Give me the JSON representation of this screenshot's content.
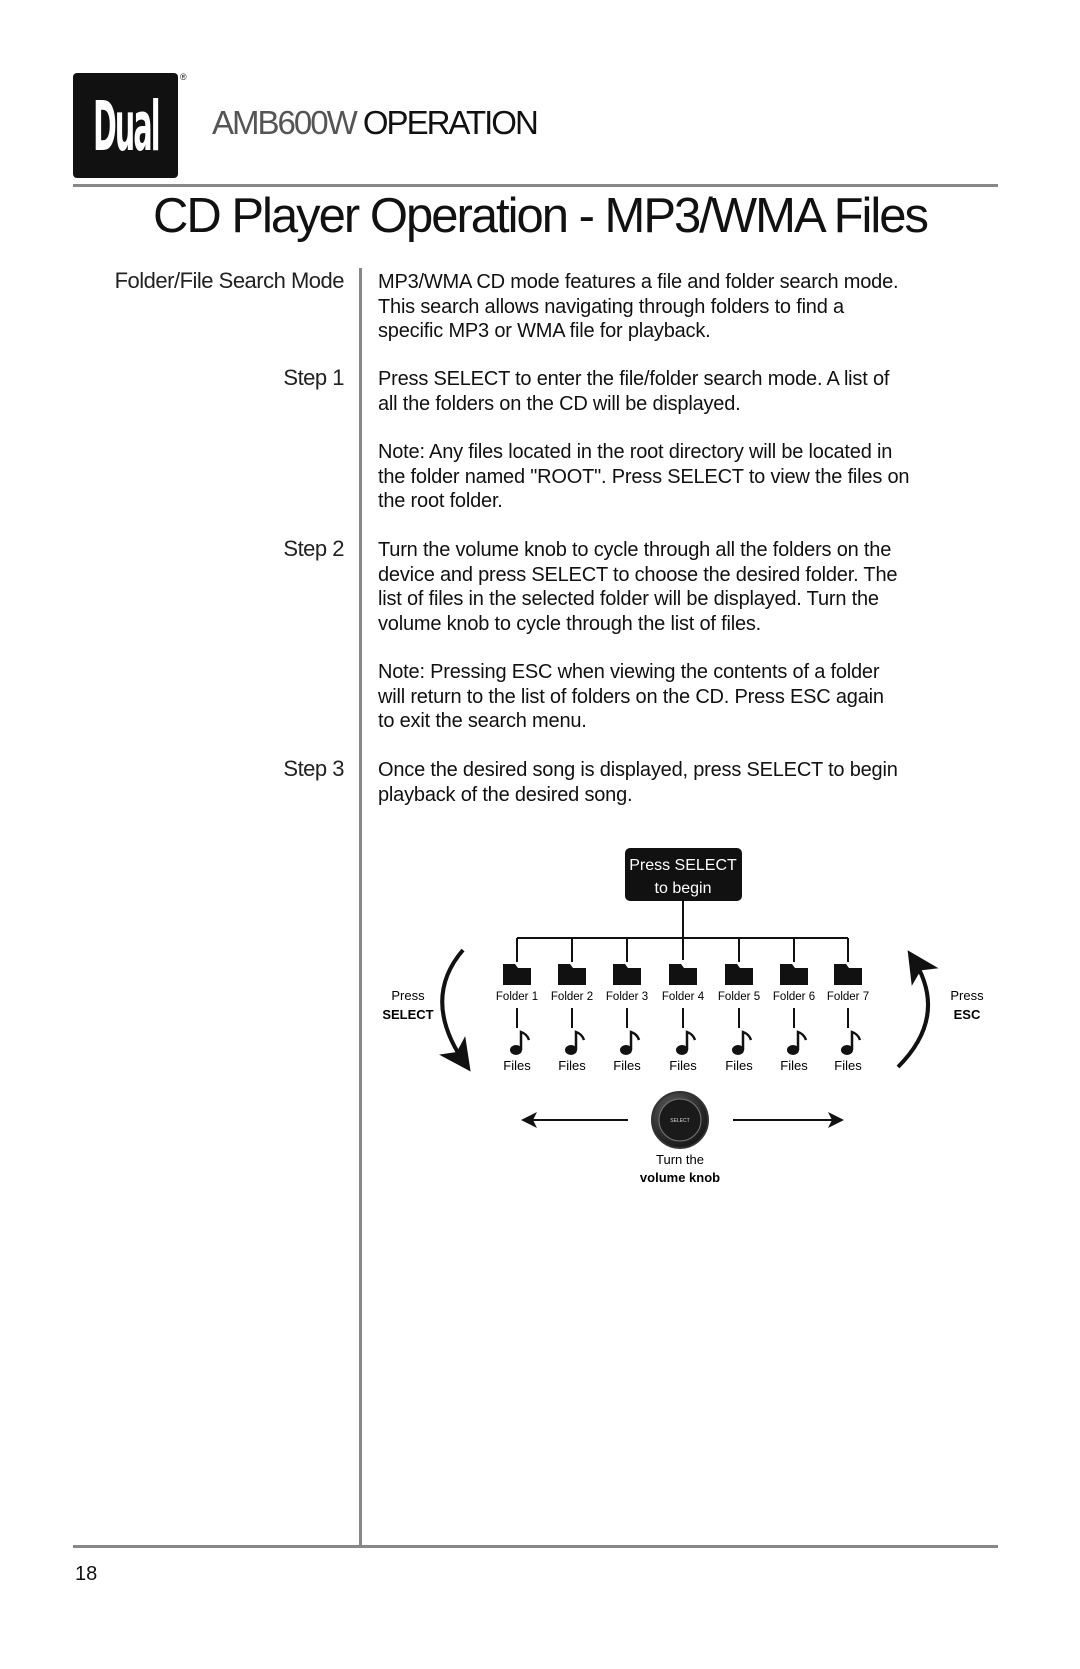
{
  "header": {
    "logo_text": "Dual",
    "model": "AMB600W",
    "section": "OPERATION"
  },
  "title": "CD Player Operation - MP3/WMA Files",
  "labels": {
    "mode": "Folder/File Search Mode",
    "step1": "Step 1",
    "step2": "Step 2",
    "step3": "Step 3"
  },
  "paragraphs": {
    "intro": [
      "MP3/WMA CD mode features a file and folder search mode.",
      "This search allows navigating through folders to find a",
      "specific MP3 or WMA file for playback."
    ],
    "step1": [
      "Press SELECT to enter the file/folder search mode. A list of",
      "all the folders on the CD will be displayed."
    ],
    "note1": [
      "Note: Any files located in the root directory will be located in",
      "the folder named \"ROOT\". Press SELECT to view the files on",
      "the root folder."
    ],
    "step2": [
      "Turn the volume knob to cycle through all the folders on the",
      "device and press SELECT to choose the desired folder. The",
      "list of files in the selected folder will be displayed. Turn the",
      "volume knob to cycle through the list of files."
    ],
    "note2": [
      "Note: Pressing ESC when viewing the contents of a folder",
      "will return to the list of folders on the CD. Press ESC again",
      "to exit the search menu."
    ],
    "step3": [
      "Once the desired song is displayed, press SELECT to begin",
      "playback of the desired song."
    ]
  },
  "diagram": {
    "start_box": [
      "Press SELECT",
      "to begin"
    ],
    "folders": [
      "Folder 1",
      "Folder 2",
      "Folder 3",
      "Folder 4",
      "Folder 5",
      "Folder 6",
      "Folder 7"
    ],
    "files_label": "Files",
    "left_arrow": {
      "line1": "Press",
      "line2": "SELECT"
    },
    "right_arrow": {
      "line1": "Press",
      "line2": "ESC"
    },
    "knob_label": "SELECT",
    "knob_caption": {
      "line1": "Turn the",
      "line2": "volume knob"
    }
  },
  "page_number": "18"
}
